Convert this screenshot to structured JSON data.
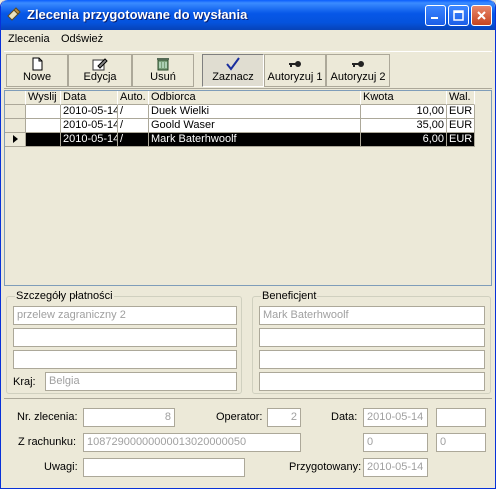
{
  "window": {
    "title": "Zlecenia przygotowane do wysłania"
  },
  "menu": [
    {
      "label": "Zlecenia"
    },
    {
      "label": "Odśwież"
    }
  ],
  "toolbar": {
    "buttons": [
      {
        "label": "Nowe",
        "icon": "new-document-icon"
      },
      {
        "label": "Edycja",
        "icon": "edit-icon"
      },
      {
        "label": "Usuń",
        "icon": "delete-icon"
      },
      {
        "label": "Zaznacz",
        "icon": "check-icon"
      },
      {
        "label": "Autoryzuj 1",
        "icon": "key-icon"
      },
      {
        "label": "Autoryzuj 2",
        "icon": "key-icon"
      }
    ]
  },
  "grid": {
    "columns": [
      "Wyslij",
      "Data",
      "Auto.",
      "Odbiorca",
      "Kwota",
      "Wal."
    ],
    "rows": [
      {
        "wyslij": "",
        "data": "2010-05-14",
        "auto": "/",
        "odbiorca": "Duek Wielki",
        "kwota": "10,00",
        "wal": "EUR",
        "selected": false
      },
      {
        "wyslij": "",
        "data": "2010-05-14",
        "auto": "/",
        "odbiorca": "Goold Waser",
        "kwota": "35,00",
        "wal": "EUR",
        "selected": false
      },
      {
        "wyslij": "",
        "data": "2010-05-14",
        "auto": "/",
        "odbiorca": "Mark Baterhwoolf",
        "kwota": "6,00",
        "wal": "EUR",
        "selected": true
      }
    ]
  },
  "payment": {
    "legend": "Szczegóły płatności",
    "line1": "przelew zagraniczny 2",
    "line2": "",
    "line3": "",
    "country_label": "Kraj:",
    "country": "Belgia"
  },
  "beneficiary": {
    "legend": "Beneficjent",
    "line1": "Mark Baterhwoolf",
    "line2": "",
    "line3": "",
    "line4": ""
  },
  "details": {
    "order_no_label": "Nr. zlecenia:",
    "order_no": "8",
    "operator_label": "Operator:",
    "operator": "2",
    "date_label": "Data:",
    "date": "2010-05-14",
    "date_extra": "",
    "account_label": "Z rachunku:",
    "account": "10872900000000013020000050",
    "num1": "0",
    "num2": "0",
    "notes_label": "Uwagi:",
    "notes": "",
    "prepared_label": "Przygotowany:",
    "prepared": "2010-05-14"
  }
}
